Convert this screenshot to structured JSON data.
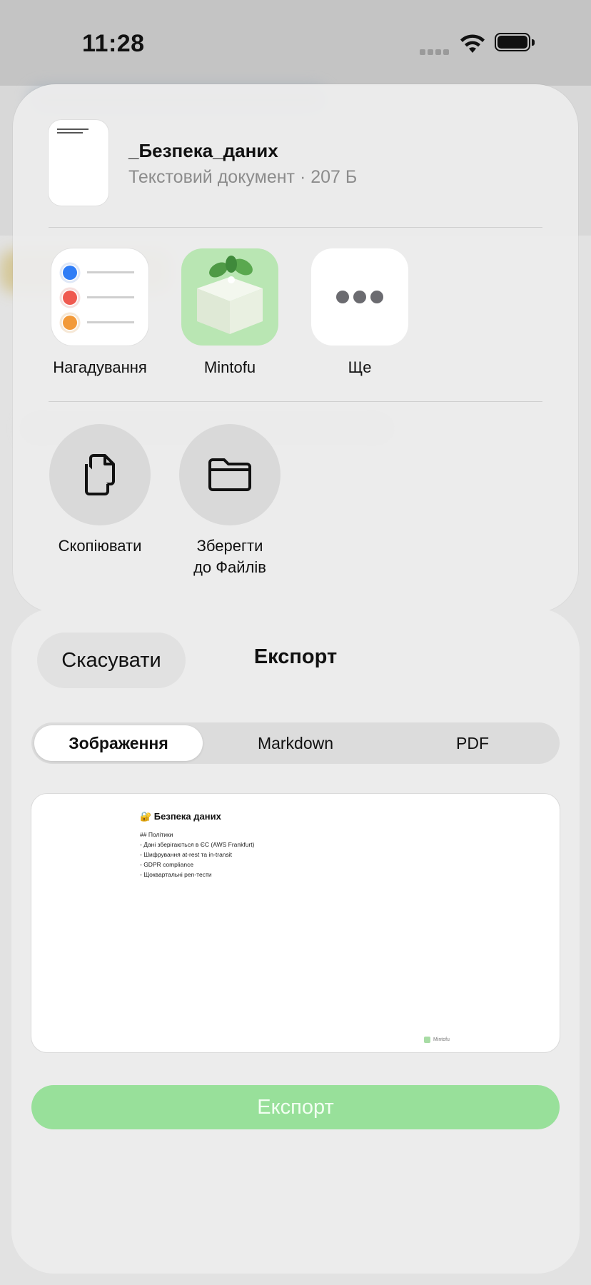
{
  "status_bar": {
    "time": "11:28"
  },
  "share_sheet": {
    "document": {
      "title": "_Безпека_даних",
      "subtitle": "Текстовий документ · 207 Б"
    },
    "apps": [
      {
        "label": "Нагадування",
        "icon": "reminders-icon"
      },
      {
        "label": "Mintofu",
        "icon": "mintofu-app-icon"
      },
      {
        "label": "Ще",
        "icon": "more-icon"
      }
    ],
    "actions": [
      {
        "label": "Скопіювати",
        "icon": "copy-icon"
      },
      {
        "label_line1": "Зберегти",
        "label_line2": "до Файлів",
        "icon": "folder-icon"
      }
    ]
  },
  "export_sheet": {
    "cancel_label": "Скасувати",
    "title": "Експорт",
    "tabs": [
      {
        "label": "Зображення",
        "active": true
      },
      {
        "label": "Markdown",
        "active": false
      },
      {
        "label": "PDF",
        "active": false
      }
    ],
    "preview": {
      "title": "🔐 Безпека даних",
      "lines": [
        "## Політики",
        "- Дані зберігаються в ЄС (AWS Frankfurt)",
        "- Шифрування at-rest та in-transit",
        "- GDPR compliance",
        "- Щоквартальні pen-тести"
      ],
      "brand": "Mintofu"
    },
    "export_label": "Експорт",
    "accent_color": "#98e09a"
  }
}
